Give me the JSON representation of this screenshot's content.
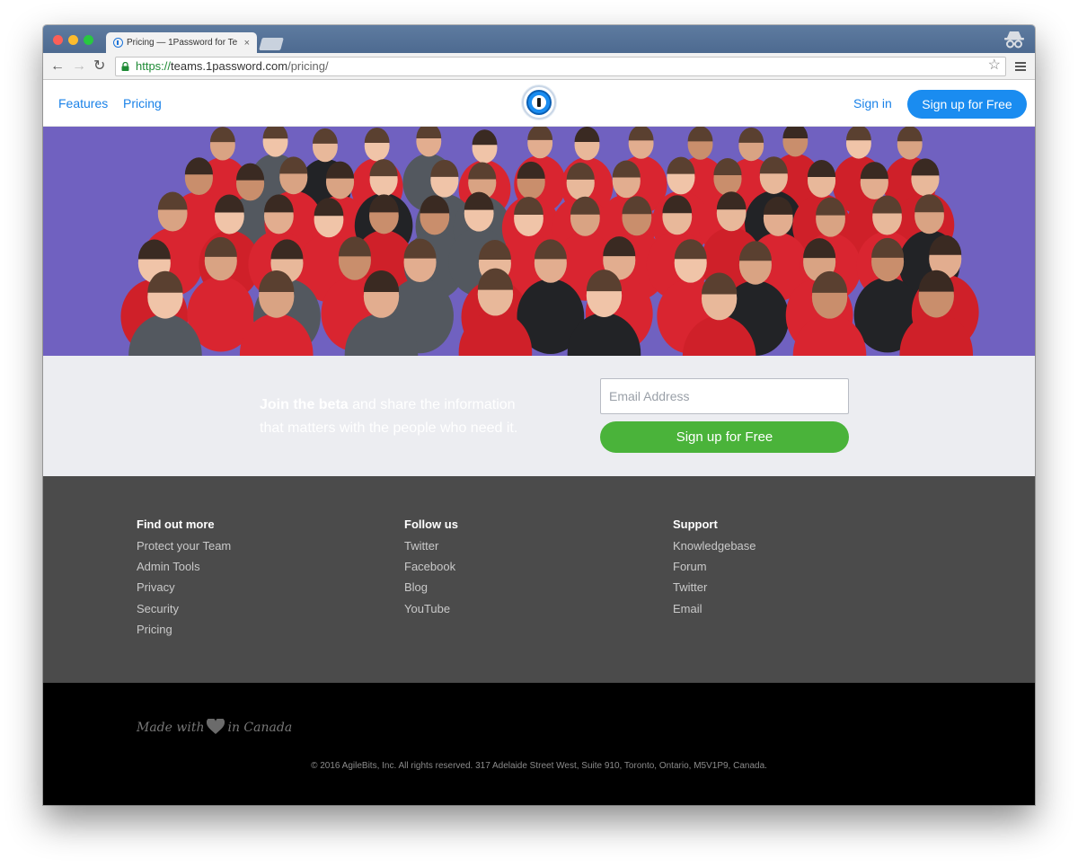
{
  "browser": {
    "tab_title": "Pricing — 1Password for Te",
    "tab_close": "×",
    "url_scheme": "https://",
    "url_host": "teams.1password.com",
    "url_path": "/pricing/",
    "icons": [
      "back-arrow-icon",
      "forward-arrow-icon",
      "reload-icon",
      "lock-icon",
      "star-icon",
      "menu-icon",
      "incognito-icon"
    ]
  },
  "header": {
    "nav": [
      "Features",
      "Pricing"
    ],
    "sign_in": "Sign in",
    "signup_button": "Sign up for Free",
    "brand_color": "#1a8cf0"
  },
  "hero": {
    "background_color": "#7061c0"
  },
  "beta": {
    "text_strong": "Join the beta",
    "text_rest": " and share the information that matters with the people who need it.",
    "email_placeholder": "Email Address",
    "signup_button": "Sign up for Free",
    "button_color": "#4ab33a"
  },
  "footer": {
    "columns": [
      {
        "heading": "Find out more",
        "links": [
          "Protect your Team",
          "Admin Tools",
          "Privacy",
          "Security",
          "Pricing"
        ]
      },
      {
        "heading": "Follow us",
        "links": [
          "Twitter",
          "Facebook",
          "Blog",
          "YouTube"
        ]
      },
      {
        "heading": "Support",
        "links": [
          "Knowledgebase",
          "Forum",
          "Twitter",
          "Email"
        ]
      }
    ]
  },
  "bottom": {
    "made_with": "Made with",
    "in_canada": "in Canada",
    "copyright": "© 2016 AgileBits, Inc. All rights reserved. 317 Adelaide Street West, Suite 910, Toronto, Ontario, M5V1P9, Canada."
  }
}
